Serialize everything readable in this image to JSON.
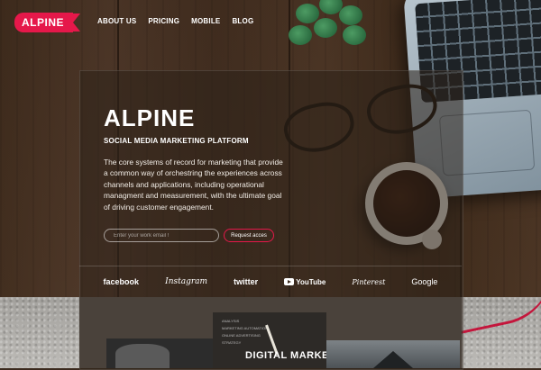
{
  "header": {
    "logo": "ALPINE",
    "nav": [
      "ABOUT US",
      "PRICING",
      "MOBILE",
      "BLOG"
    ]
  },
  "hero": {
    "title": "ALPINE",
    "subtitle": "SOCIAL MEDIA MARKETING PLATFORM",
    "description": "The core systems of record for marketing that provide a common way of orchestring the experiences across channels and applications, including operational managment and measurement, with the ultimate goal of driving customer engagement.",
    "email_placeholder": "Enter your work email !",
    "cta_label": "Request acces"
  },
  "brands": [
    "facebook",
    "Instagram",
    "twitter",
    "YouTube",
    "Pinterest",
    "Google"
  ],
  "showcase": {
    "card_text": "DIGITAL MARKETING",
    "card_small_lines": [
      "ANALYSIS",
      "MARKETING AUTOMATION",
      "ONLINE ADVERTISING",
      "STRATEGY"
    ]
  },
  "colors": {
    "accent": "#e5184a",
    "panel": "#2d221a"
  }
}
